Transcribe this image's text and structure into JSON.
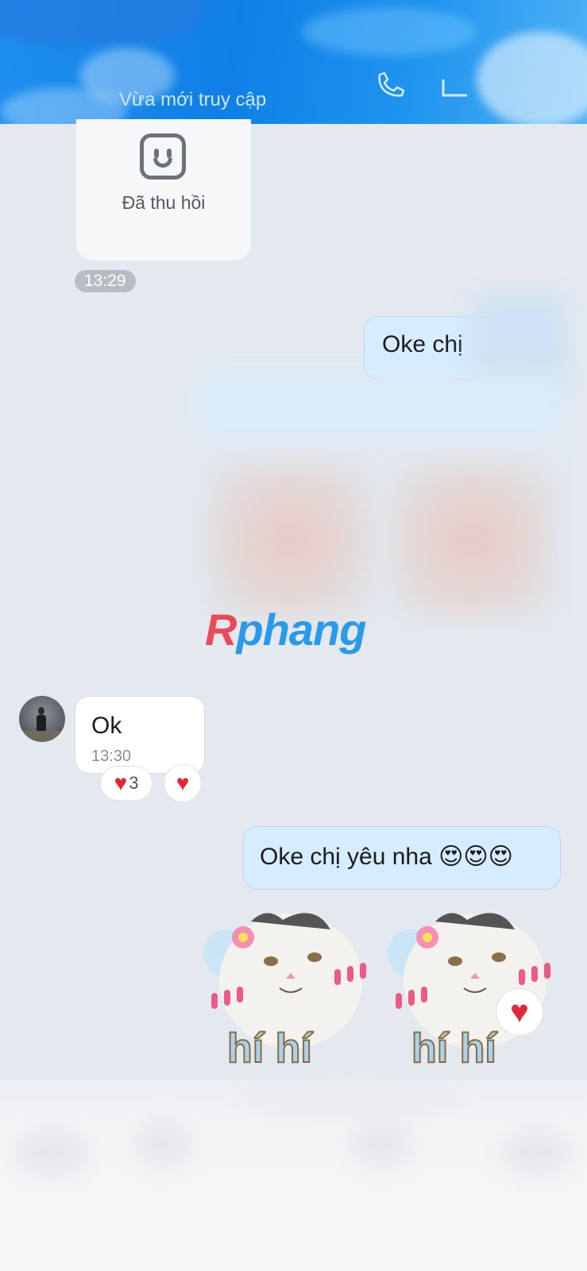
{
  "header": {
    "status_text": "Vừa mới truy cập",
    "call_icon": "phone-icon",
    "video_icon": "video-icon"
  },
  "messages": {
    "recalled_label": "Đã thu hồi",
    "time_1": "13:29",
    "sent_1": "Oke chị",
    "recv_1": "Ok",
    "recv_1_time": "13:30",
    "reaction_count": "3",
    "sent_2": "Oke chị yêu nha 😍😍😍",
    "sticker_text": "hí hí"
  },
  "watermark": {
    "first": "R",
    "rest": "phang"
  },
  "colors": {
    "header": "#1e8ff0",
    "sent_bubble": "#d6ecff",
    "heart": "#e3263b"
  }
}
